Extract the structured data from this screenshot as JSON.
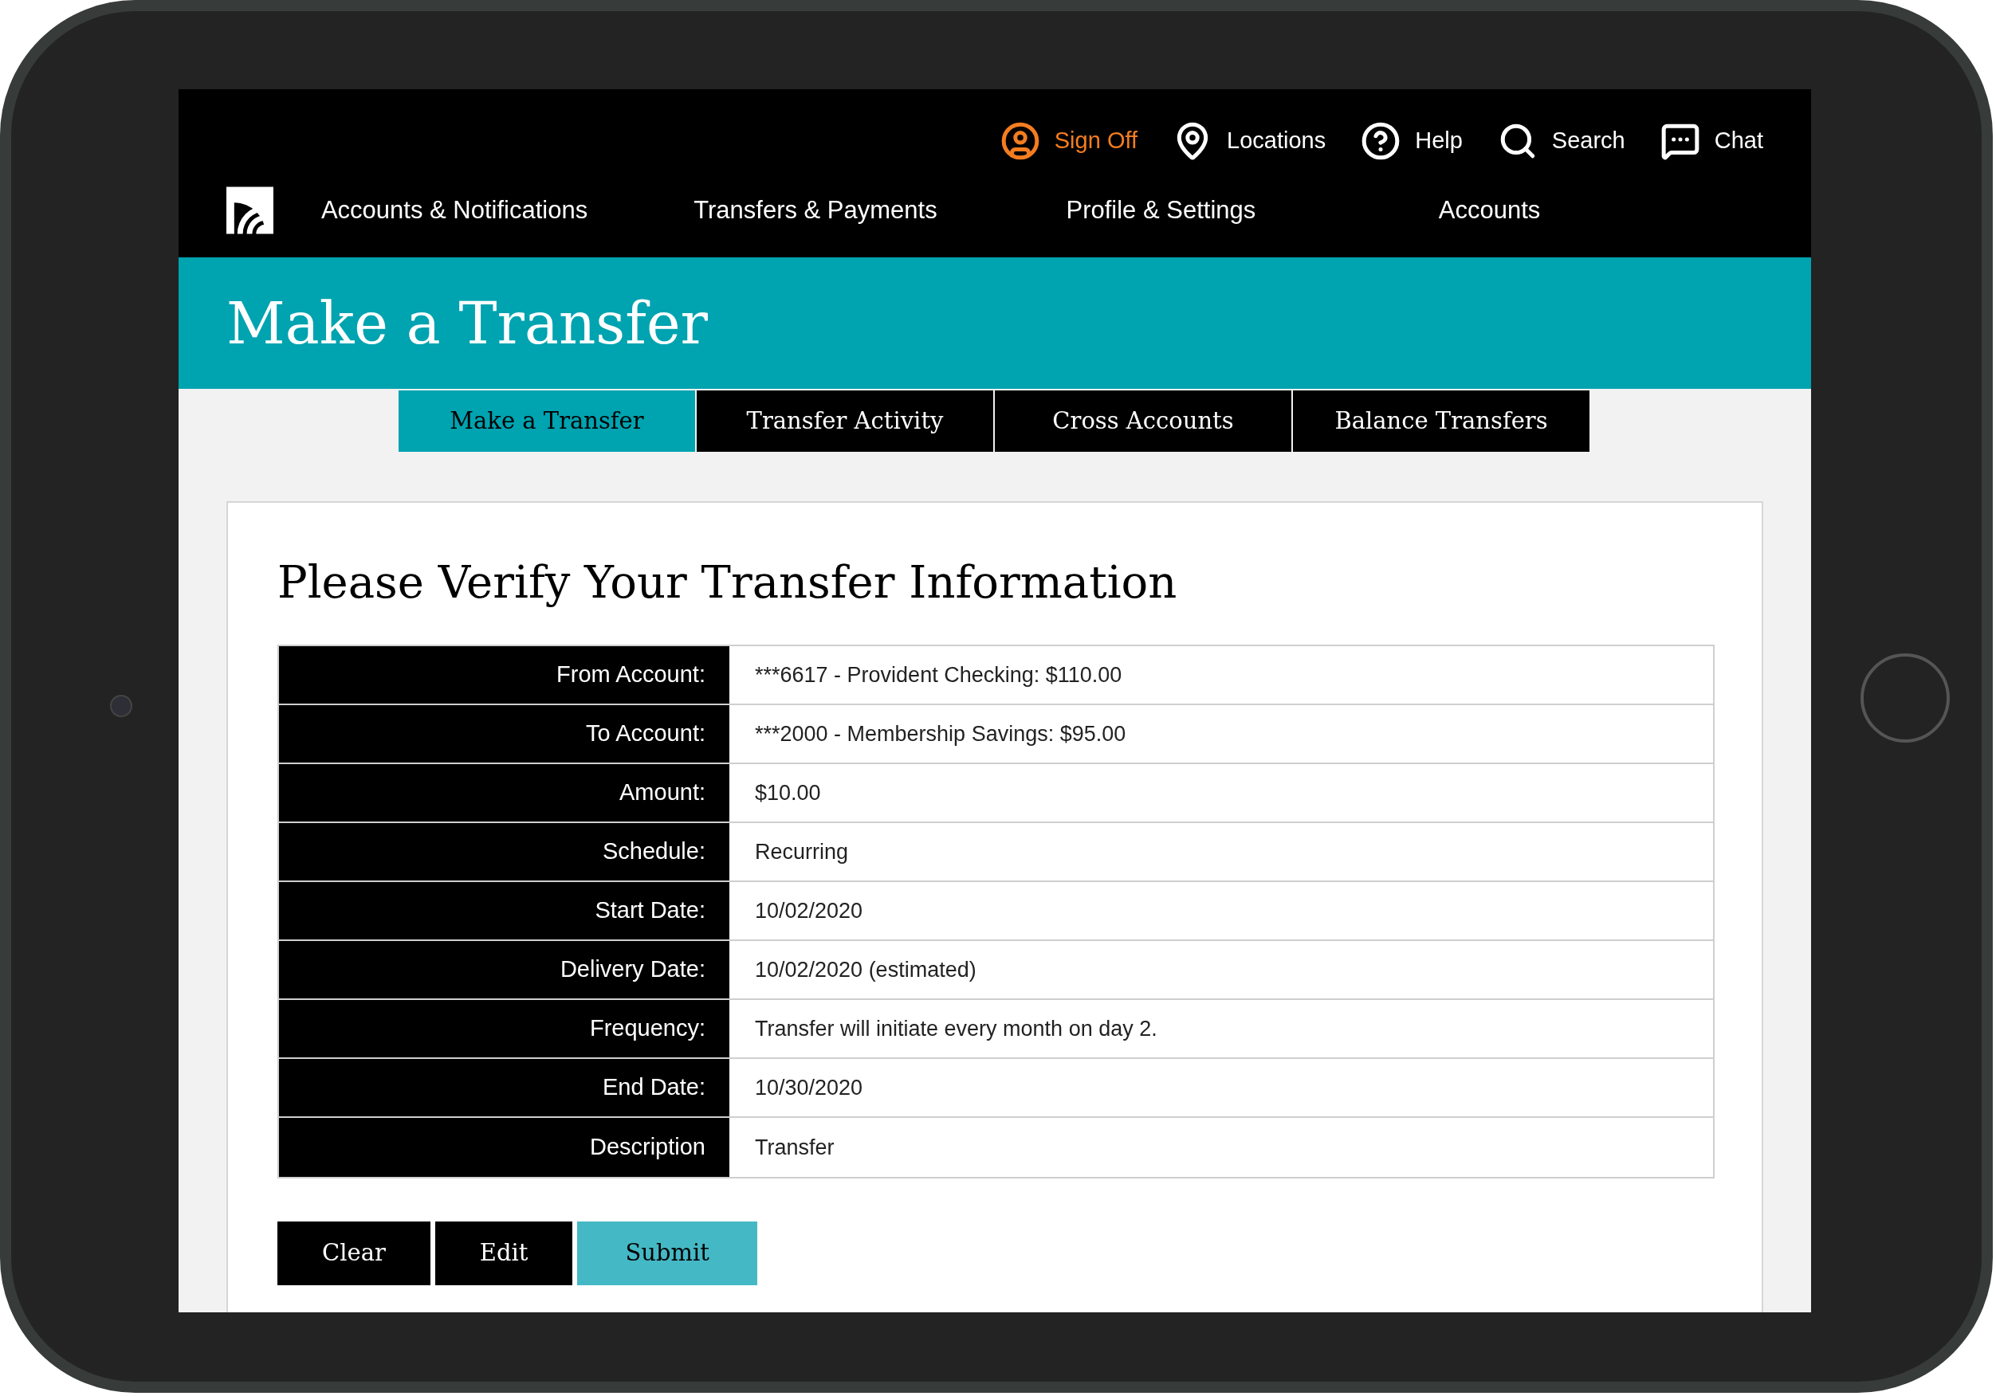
{
  "utility_links": [
    {
      "kind": "signoff",
      "label": "Sign Off"
    },
    {
      "kind": "location",
      "label": "Locations"
    },
    {
      "kind": "help",
      "label": "Help"
    },
    {
      "kind": "search",
      "label": "Search"
    },
    {
      "kind": "chat",
      "label": "Chat"
    }
  ],
  "nav": [
    "Accounts & Notifications",
    "Transfers & Payments",
    "Profile & Settings",
    "Accounts"
  ],
  "page_title": "Make a Transfer",
  "tabs": [
    {
      "label": "Make a Transfer",
      "selected": true
    },
    {
      "label": "Transfer Activity",
      "selected": false
    },
    {
      "label": "Cross Accounts",
      "selected": false
    },
    {
      "label": "Balance Transfers",
      "selected": false
    }
  ],
  "card": {
    "heading": "Please Verify Your Transfer Information",
    "rows": [
      {
        "label": "From Account:",
        "value": "***6617 - Provident Checking: $110.00"
      },
      {
        "label": "To Account:",
        "value": "***2000 - Membership Savings: $95.00"
      },
      {
        "label": "Amount:",
        "value": "$10.00"
      },
      {
        "label": "Schedule:",
        "value": "Recurring"
      },
      {
        "label": "Start Date:",
        "value": "10/02/2020"
      },
      {
        "label": "Delivery Date:",
        "value": "10/02/2020 (estimated)"
      },
      {
        "label": "Frequency:",
        "value": "Transfer will initiate every month on day 2."
      },
      {
        "label": "End Date:",
        "value": "10/30/2020"
      },
      {
        "label": "Description",
        "value": "Transfer"
      }
    ],
    "buttons": [
      {
        "label": "Clear",
        "kind": "secondary"
      },
      {
        "label": "Edit",
        "kind": "secondary"
      },
      {
        "label": "Submit",
        "kind": "primary"
      }
    ]
  }
}
